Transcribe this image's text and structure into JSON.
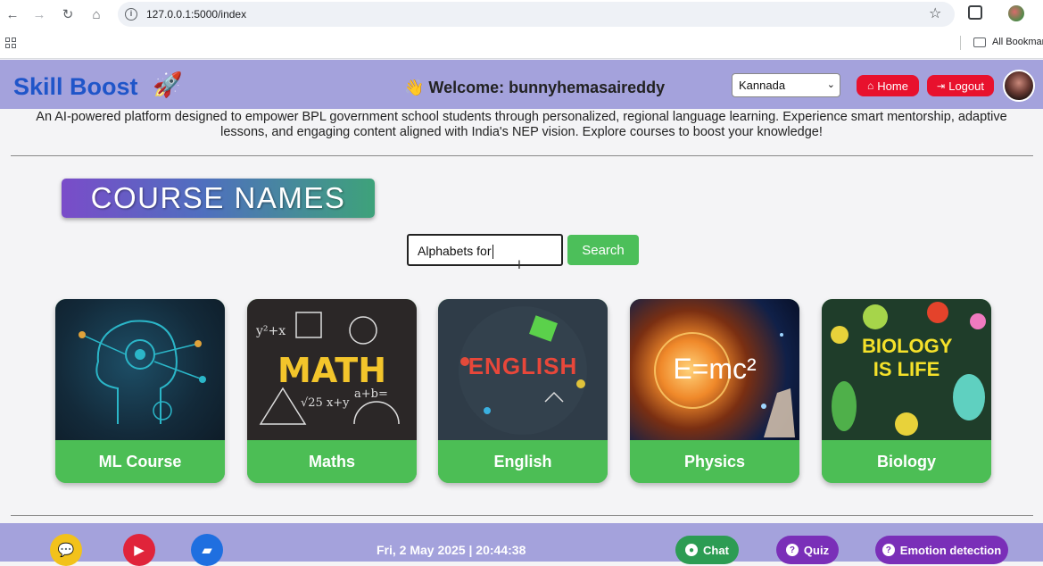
{
  "browser": {
    "url": "127.0.0.1:5000/index",
    "bookmarks_label": "All Bookmar"
  },
  "header": {
    "brand": "Skill Boost",
    "rocket": "🚀",
    "welcome": "👋 Welcome: bunnyhemasaireddy",
    "language_selected": "Kannada",
    "home_label": "Home",
    "logout_label": "Logout"
  },
  "description": "An AI-powered platform designed to empower BPL government school students through personalized, regional language learning. Experience smart mentorship, adaptive lessons, and engaging content aligned with India's NEP vision. Explore courses to boost your knowledge!",
  "main": {
    "course_heading": "COURSE NAMES",
    "search_value": "Alphabets for",
    "search_button": "Search",
    "courses": [
      {
        "label": "ML Course",
        "art": "MACHINE LEARNING"
      },
      {
        "label": "Maths",
        "art": "MATH"
      },
      {
        "label": "English",
        "art": "ENGLISH"
      },
      {
        "label": "Physics",
        "art": "E=mc²"
      },
      {
        "label": "Biology",
        "art": "BIOLOGY IS LIFE"
      }
    ]
  },
  "footer": {
    "datetime": "Fri, 2 May 2025 | 20:44:38",
    "chat_label": "Chat",
    "quiz_label": "Quiz",
    "emotion_label": "Emotion detection"
  },
  "colors": {
    "header_bg": "#a4a2dc",
    "brand": "#1f55c9",
    "danger": "#e8112d",
    "success": "#4cbe55",
    "accent_purple": "#7a2fb8"
  }
}
